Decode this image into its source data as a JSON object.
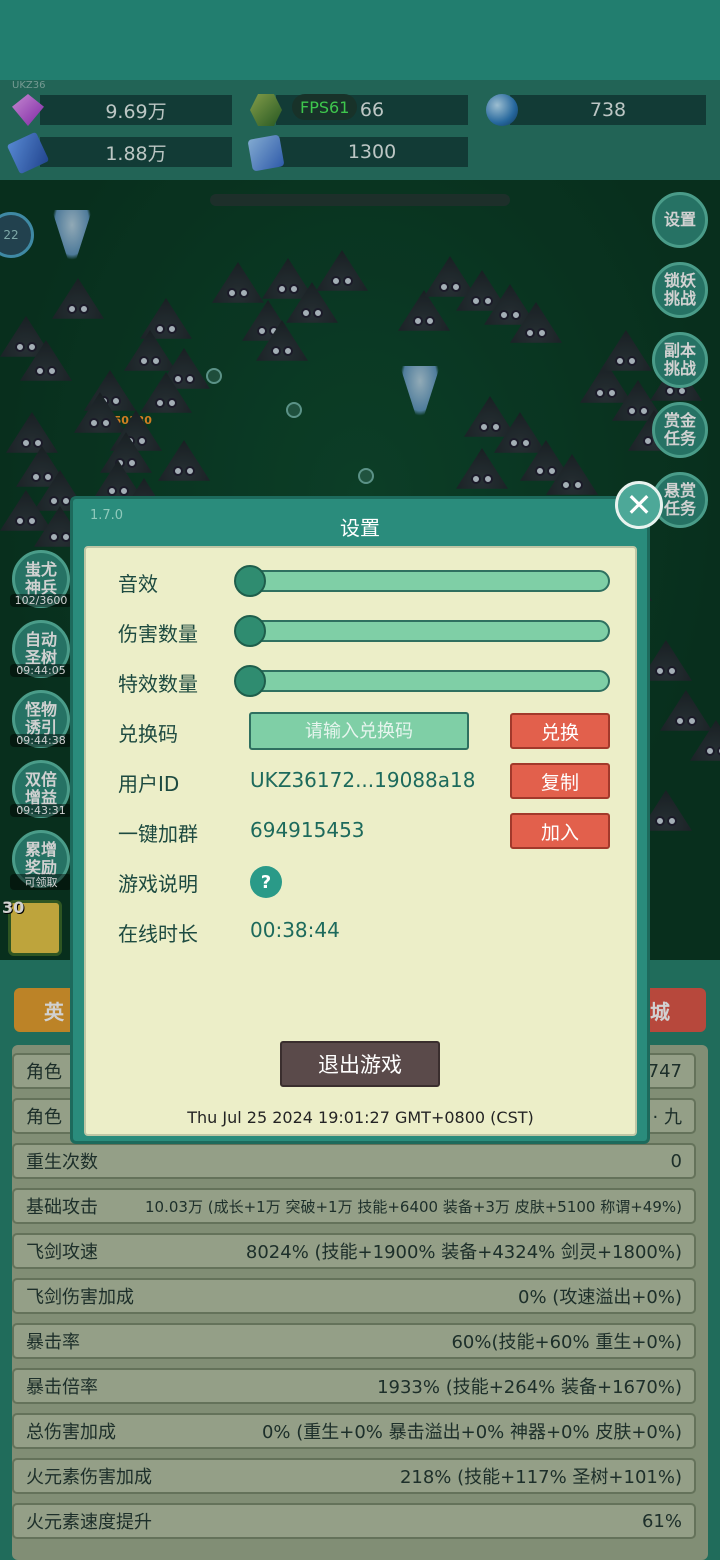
{
  "top_left_tag": "UKZ36",
  "resources": {
    "gems": "9.69万",
    "green_gem": "66",
    "orbs": "738",
    "books": "1.88万",
    "scrolls": "1300"
  },
  "fps": "FPS61",
  "avatar_level": "22",
  "damage_popup": "450130",
  "right_buttons": [
    "设置",
    "锁妖\n挑战",
    "副本\n挑战",
    "赏金\n任务",
    "悬赏\n任务"
  ],
  "left_buttons": [
    {
      "label": "蚩尤\n神兵",
      "sub": "102/3600"
    },
    {
      "label": "自动\n圣树",
      "sub": "09:44:05"
    },
    {
      "label": "怪物\n诱引",
      "sub": "09:44:38"
    },
    {
      "label": "双倍\n增益",
      "sub": "09:43:31"
    },
    {
      "label": "累增\n奖励",
      "sub": "可领取"
    }
  ],
  "weapon_level": "30",
  "tabs": {
    "hero": "英",
    "shop": "城"
  },
  "stats": [
    {
      "label": "角色",
      "value": "747"
    },
    {
      "label": "角色",
      "value": "· 九"
    },
    {
      "label": "重生次数",
      "value": "0"
    },
    {
      "label": "基础攻击",
      "value": "10.03万 (成长+1万 突破+1万 技能+6400 装备+3万 皮肤+5100 称谓+49%)"
    },
    {
      "label": "飞剑攻速",
      "value": "8024% (技能+1900% 装备+4324% 剑灵+1800%)"
    },
    {
      "label": "飞剑伤害加成",
      "value": "0% (攻速溢出+0%)"
    },
    {
      "label": "暴击率",
      "value": "60%(技能+60% 重生+0%)"
    },
    {
      "label": "暴击倍率",
      "value": "1933% (技能+264% 装备+1670%)"
    },
    {
      "label": "总伤害加成",
      "value": "0% (重生+0% 暴击溢出+0% 神器+0% 皮肤+0%)"
    },
    {
      "label": "火元素伤害加成",
      "value": "218% (技能+117% 圣树+101%)"
    },
    {
      "label": "火元素速度提升",
      "value": "61%"
    }
  ],
  "dialog": {
    "version": "1.7.0",
    "title": "设置",
    "sound_label": "音效",
    "damage_count_label": "伤害数量",
    "effect_count_label": "特效数量",
    "sound_level": 0,
    "damage_count_level": 0,
    "effect_count_level": 0,
    "redeem_label": "兑换码",
    "redeem_placeholder": "请输入兑换码",
    "redeem_button": "兑换",
    "user_id_label": "用户ID",
    "user_id_value": "UKZ36172...19088a18",
    "copy_button": "复制",
    "group_label": "一键加群",
    "group_value": "694915453",
    "join_button": "加入",
    "guide_label": "游戏说明",
    "guide_icon": "?",
    "online_label": "在线时长",
    "online_value": "00:38:44",
    "exit_button": "退出游戏",
    "timestamp": "Thu Jul 25 2024 19:01:27 GMT+0800 (CST)"
  }
}
